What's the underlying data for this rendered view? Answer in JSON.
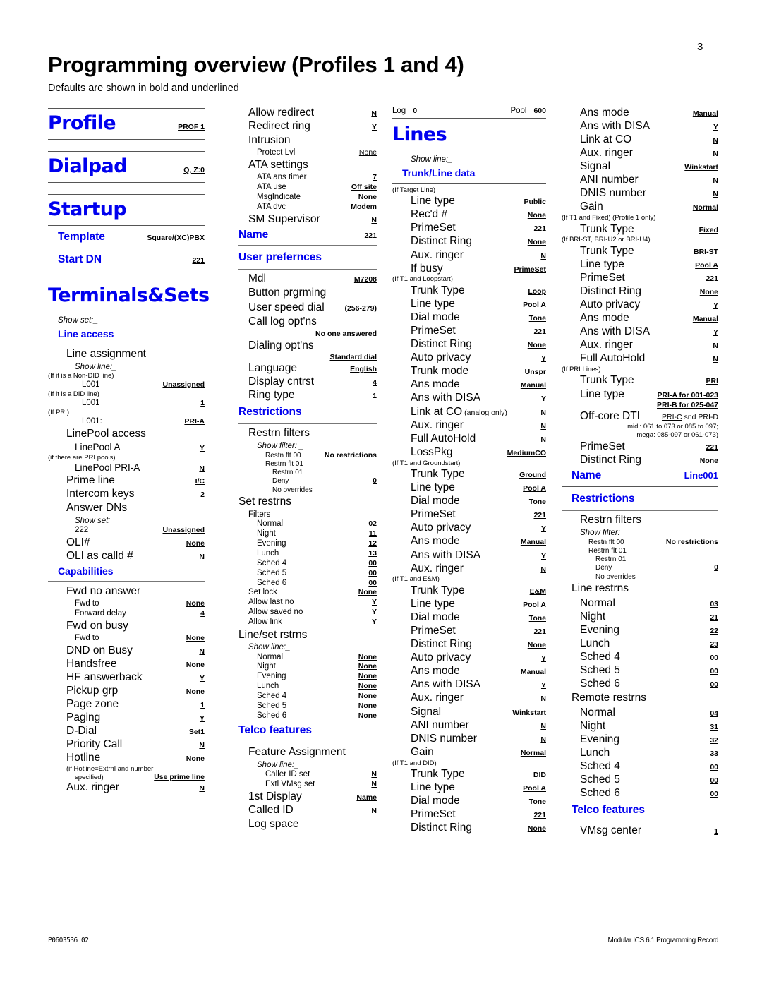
{
  "page": {
    "number": "3",
    "title": "Programming overview (Profiles 1 and 4)",
    "subtitle": "Defaults are shown in bold and underlined",
    "footer_left": "P0603536  02",
    "footer_right": "Modular ICS 6.1 Programming Record",
    "accent_color": "#0000ee"
  },
  "col1": {
    "profile": {
      "heading": "Profile",
      "value": "PROF 1"
    },
    "dialpad": {
      "heading": "Dialpad",
      "value": "Q, Z:0"
    },
    "startup": {
      "heading": "Startup"
    },
    "template": {
      "label": "Template",
      "value": "Square/(XC)PBX"
    },
    "start_dn": {
      "label": "Start DN",
      "value": "221"
    },
    "terminals": {
      "heading": "Terminals&Sets",
      "show_set": "Show set:_"
    },
    "line_access": {
      "heading": "Line access",
      "line_assignment": "Line assignment",
      "show_line": "Show line:_",
      "note_nondid": "(If it is a Non-DID line)",
      "l001_nondid_label": "L001",
      "l001_nondid_value": "Unassigned",
      "note_did": "(If it is a DID line)",
      "l001_did_label": "L001",
      "l001_did_value": "1",
      "note_pri": "(If PRI)",
      "l001_pri_label": "L001:",
      "l001_pri_value": "PRI-A",
      "linepool_access": "LinePool access",
      "linepool_a_label": "LinePool  A",
      "linepool_a_value": "Y",
      "note_pri_pools": "(if there are PRI pools)",
      "linepool_pria_label": "LinePool PRI-A",
      "linepool_pria_value": "N",
      "prime_line_label": "Prime line",
      "prime_line_value": "I/C",
      "intercom_keys_label": "Intercom keys",
      "intercom_keys_value": "2",
      "answer_dns": "Answer DNs",
      "answer_show_set": "Show set:_",
      "dn222_label": "222",
      "dn222_value": "Unassigned",
      "oli_label": "OLI#",
      "oli_value": "None",
      "oli_calld_label": "OLI as calld #",
      "oli_calld_value": "N"
    },
    "capabilities": {
      "heading": "Capabilities",
      "fwd_no_answer": "Fwd no answer",
      "fwd_to_1_label": "Fwd to",
      "fwd_to_1_value": "None",
      "forward_delay_label": "Forward delay",
      "forward_delay_value": "4",
      "fwd_on_busy": "Fwd on busy",
      "fwd_to_2_label": "Fwd to",
      "fwd_to_2_value": "None",
      "dnd_label": "DND on Busy",
      "dnd_value": "N",
      "handsfree_label": "Handsfree",
      "handsfree_value": "None",
      "hf_answerback_label": "HF answerback",
      "hf_answerback_value": "Y",
      "pickup_grp_label": "Pickup grp",
      "pickup_grp_value": "None",
      "page_zone_label": "Page zone",
      "page_zone_value": "1",
      "paging_label": "Paging",
      "paging_value": "Y",
      "ddial_label": "D-Dial",
      "ddial_value": "Set1",
      "priority_call_label": "Priority Call",
      "priority_call_value": "N",
      "hotline_label": "Hotline",
      "hotline_value": "None",
      "hotline_note1": "(if Hotline=Extrnl and number",
      "hotline_note2": "specified)",
      "hotline_note_value": "Use prime line",
      "aux_ringer_label": "Aux. ringer",
      "aux_ringer_value": "N"
    }
  },
  "col2": {
    "allow_redirect": {
      "label": "Allow redirect",
      "value": "N"
    },
    "redirect_ring": {
      "label": "Redirect ring",
      "value": "Y"
    },
    "intrusion": {
      "label": "Intrusion"
    },
    "protect_lvl": {
      "label": "Protect Lvl",
      "value": "None"
    },
    "ata_settings": {
      "label": "ATA settings"
    },
    "ata_ans_timer": {
      "label": "ATA ans timer",
      "value": "7"
    },
    "ata_use": {
      "label": "ATA use",
      "value": "Off site"
    },
    "msgindicate": {
      "label": "MsgIndicate",
      "value": "None"
    },
    "ata_dvc": {
      "label": "ATA dvc",
      "value": "Modem"
    },
    "sm_supervisor": {
      "label": "SM Supervisor",
      "value": "N"
    },
    "name": {
      "label": "Name",
      "value": "221"
    },
    "user_prefs": {
      "heading": "User prefernces",
      "mdl_label": "Mdl",
      "mdl_value": "M7208",
      "button_prgrming": "Button prgrming",
      "user_speed_dial_label": "User speed dial",
      "user_speed_dial_value": "(256-279)",
      "call_log_optns": "Call log opt'ns",
      "call_log_value": "No one answered",
      "dialing_optns": "Dialing opt'ns",
      "dialing_value": "Standard dial",
      "language_label": "Language",
      "language_value": "English",
      "display_cntrst_label": "Display cntrst",
      "display_cntrst_value": "4",
      "ring_type_label": "Ring type",
      "ring_type_value": "1"
    },
    "restrictions": {
      "heading": "Restrictions",
      "restrn_filters": "Restrn filters",
      "show_filter": "Show filter: _",
      "restn_flt_00_label": "Restn flt 00",
      "restn_flt_00_value": "No restrictions",
      "restrn_flt_01": "Restrn flt 01",
      "restrn_01": "Restrn 01",
      "deny_label": "Deny",
      "deny_value": "0",
      "no_overrides": "No overrides",
      "set_restrns": "Set restrns",
      "filters": "Filters",
      "filter_rows": [
        {
          "label": "Normal",
          "value": "02"
        },
        {
          "label": "Night",
          "value": "11"
        },
        {
          "label": "Evening",
          "value": "12"
        },
        {
          "label": "Lunch",
          "value": "13"
        },
        {
          "label": "Sched 4",
          "value": "00"
        },
        {
          "label": "Sched 5",
          "value": "00"
        },
        {
          "label": "Sched 6",
          "value": "00"
        }
      ],
      "set_lock_label": "Set lock",
      "set_lock_value": "None",
      "allow_last_no_label": "Allow last no",
      "allow_last_no_value": "Y",
      "allow_saved_no_label": "Allow saved no",
      "allow_saved_no_value": "Y",
      "allow_link_label": "Allow link",
      "allow_link_value": "Y",
      "line_set_rstrns": "Line/set rstrns",
      "show_line": "Show line:_",
      "lineset_rows": [
        {
          "label": "Normal",
          "value": "None"
        },
        {
          "label": "Night",
          "value": "None"
        },
        {
          "label": "Evening",
          "value": "None"
        },
        {
          "label": "Lunch",
          "value": "None"
        },
        {
          "label": "Sched 4",
          "value": "None"
        },
        {
          "label": "Sched 5",
          "value": "None"
        },
        {
          "label": "Sched 6",
          "value": "None"
        }
      ]
    },
    "telco": {
      "heading": "Telco features",
      "feature_assignment": "Feature Assignment",
      "show_line": "Show line:_",
      "caller_id_set_label": "Caller ID set",
      "caller_id_set_value": "N",
      "extl_vmsg_set_label": "Extl VMsg set",
      "extl_vmsg_set_value": "N",
      "first_display_label": "1st Display",
      "first_display_value": "Name",
      "called_id_label": "Called ID",
      "called_id_value": "N",
      "log_space": "Log space"
    }
  },
  "col3": {
    "log_label": "Log",
    "log_value": "0",
    "pool_label": "Pool",
    "pool_value": "600",
    "lines_heading": "Lines",
    "show_line": "Show line:_",
    "trunk_line_data": "Trunk/Line data",
    "target_line": {
      "note": "(If Target Line)",
      "rows": [
        {
          "label": "Line type",
          "value": "Public",
          "style": "bu"
        },
        {
          "label": "Rec'd #",
          "value": "None",
          "style": "bu"
        },
        {
          "label": "PrimeSet",
          "value": "221",
          "style": "bu"
        },
        {
          "label": "Distinct Ring",
          "value": "None",
          "style": "bu"
        },
        {
          "label": "Aux. ringer",
          "value": "N",
          "style": "bu"
        },
        {
          "label": "If busy",
          "value": "PrimeSet",
          "style": "bu"
        }
      ]
    },
    "t1_loopstart": {
      "note": "(If T1 and Loopstart)",
      "rows": [
        {
          "label": "Trunk Type",
          "value": "Loop",
          "style": "bu"
        },
        {
          "label": "Line type",
          "value": "Pool A",
          "style": "bu"
        },
        {
          "label": "Dial mode",
          "value": "Tone",
          "style": "bu"
        },
        {
          "label": "PrimeSet",
          "value": "221",
          "style": "bu"
        },
        {
          "label": "Distinct Ring",
          "value": "None",
          "style": "bu"
        },
        {
          "label": "Auto privacy",
          "value": "Y",
          "style": "bu"
        },
        {
          "label": "Trunk mode",
          "value": "Unspr",
          "style": "bu"
        },
        {
          "label": "Ans mode",
          "value": "Manual",
          "style": "bu"
        },
        {
          "label": "Ans with DISA",
          "value": "Y",
          "style": "bu"
        },
        {
          "label": "Link at CO",
          "sub": "(analog only)",
          "value": "N",
          "style": "bu"
        },
        {
          "label": "Aux. ringer",
          "value": "N",
          "style": "bu"
        },
        {
          "label": "Full AutoHold",
          "value": "N",
          "style": "bu"
        },
        {
          "label": "LossPkg",
          "value": "MediumCO",
          "style": "bu"
        }
      ]
    },
    "t1_groundstart": {
      "note": "(If T1 and Groundstart)",
      "rows": [
        {
          "label": "Trunk Type",
          "value": "Ground",
          "style": "bu"
        },
        {
          "label": "Line type",
          "value": "Pool A",
          "style": "bu"
        },
        {
          "label": "Dial mode",
          "value": "Tone",
          "style": "bu"
        },
        {
          "label": "PrimeSet",
          "value": "221",
          "style": "bu"
        },
        {
          "label": "Auto privacy",
          "value": "Y",
          "style": "bu"
        },
        {
          "label": "Ans mode",
          "value": "Manual",
          "style": "bu"
        },
        {
          "label": "Ans with DISA",
          "value": "Y",
          "style": "bu"
        },
        {
          "label": "Aux. ringer",
          "value": "N",
          "style": "bu"
        }
      ]
    },
    "t1_em": {
      "note": "(If T1 and E&M)",
      "rows": [
        {
          "label": "Trunk Type",
          "value": "E&M",
          "style": "bu"
        },
        {
          "label": "Line type",
          "value": "Pool A",
          "style": "bu"
        },
        {
          "label": "Dial mode",
          "value": "Tone",
          "style": "bu"
        },
        {
          "label": "PrimeSet",
          "value": "221",
          "style": "bu"
        },
        {
          "label": "Distinct Ring",
          "value": "None",
          "style": "bu"
        },
        {
          "label": "Auto privacy",
          "value": "Y",
          "style": "bu"
        },
        {
          "label": "Ans mode",
          "value": "Manual",
          "style": "bu"
        },
        {
          "label": "Ans with DISA",
          "value": "Y",
          "style": "bu"
        },
        {
          "label": "Aux. ringer",
          "value": "N",
          "style": "bu"
        },
        {
          "label": "Signal",
          "value": "Winkstart",
          "style": "bu"
        },
        {
          "label": "ANI number",
          "value": "N",
          "style": "bu"
        },
        {
          "label": "DNIS number",
          "value": "N",
          "style": "bu"
        },
        {
          "label": "Gain",
          "value": "Normal",
          "style": "bu"
        }
      ]
    },
    "t1_did": {
      "note": "(If T1 and DID)",
      "rows": [
        {
          "label": "Trunk Type",
          "value": "DID",
          "style": "bu"
        },
        {
          "label": "Line type",
          "value": "Pool A",
          "style": "bu"
        },
        {
          "label": "Dial mode",
          "value": "Tone",
          "style": "bu"
        },
        {
          "label": "PrimeSet",
          "value": "221",
          "style": "bu"
        },
        {
          "label": "Distinct Ring",
          "value": "None",
          "style": "bu"
        }
      ]
    }
  },
  "col4": {
    "did_cont": {
      "rows": [
        {
          "label": "Ans mode",
          "value": "Manual",
          "style": "bu"
        },
        {
          "label": "Ans with DISA",
          "value": "Y",
          "style": "bu"
        },
        {
          "label": "Link at CO",
          "value": "N",
          "style": "bu"
        },
        {
          "label": "Aux. ringer",
          "value": "N",
          "style": "bu"
        },
        {
          "label": "Signal",
          "value": "Winkstart",
          "style": "bu"
        },
        {
          "label": "ANI number",
          "value": "N",
          "style": "bu"
        },
        {
          "label": "DNIS number",
          "value": "N",
          "style": "bu"
        },
        {
          "label": "Gain",
          "value": "Normal",
          "style": "bu"
        }
      ]
    },
    "t1_fixed": {
      "note": "(If T1 and Fixed) (Profile 1 only)",
      "rows": [
        {
          "label": "Trunk Type",
          "value": "Fixed",
          "style": "bu"
        }
      ]
    },
    "bri": {
      "note": "(If BRI-ST, BRI-U2 or BRI-U4)",
      "rows": [
        {
          "label": "Trunk Type",
          "value": "BRI-ST",
          "style": "bu"
        },
        {
          "label": "Line type",
          "value": "Pool A",
          "style": "bu"
        },
        {
          "label": "PrimeSet",
          "value": "221",
          "style": "bu"
        },
        {
          "label": "Distinct Ring",
          "value": "None",
          "style": "bu"
        },
        {
          "label": "Auto privacy",
          "value": "Y",
          "style": "bu"
        },
        {
          "label": "Ans mode",
          "value": "Manual",
          "style": "bu"
        },
        {
          "label": "Ans with DISA",
          "value": "Y",
          "style": "bu"
        },
        {
          "label": "Aux. ringer",
          "value": "N",
          "style": "bu"
        },
        {
          "label": "Full AutoHold",
          "value": "N",
          "style": "bu"
        }
      ]
    },
    "pri": {
      "note": "(If PRI Lines).",
      "trunk_type_label": "Trunk Type",
      "trunk_type_value": "PRI",
      "line_type_label": "Line type",
      "line_type_value_a": "PRI-A for 001-023",
      "line_type_value_b": "PRI-B for 025-047",
      "offcore_label": "Off-core DTI",
      "offcore_value_underline": "PRI-C",
      "offcore_value_rest": " snd PRI-D",
      "offcore_note1": "midi: 061 to 073 or 085 to 097;",
      "offcore_note2": "mega: 085-097 or 061-073)",
      "primeset_label": "PrimeSet",
      "primeset_value": "221",
      "distinct_ring_label": "Distinct Ring",
      "distinct_ring_value": "None"
    },
    "name": {
      "label": "Name",
      "value": "Line001"
    },
    "restrictions": {
      "heading": "Restrictions",
      "restrn_filters": "Restrn filters",
      "show_filter": "Show filter: _",
      "restn_flt_00_label": "Restn flt 00",
      "restn_flt_00_value": "No restrictions",
      "restrn_flt_01": "Restrn flt 01",
      "restrn_01": "Restrn 01",
      "deny_label": "Deny",
      "deny_value": "0",
      "no_overrides": "No overrides",
      "line_restrns": "Line restrns",
      "line_rows": [
        {
          "label": "Normal",
          "value": "03"
        },
        {
          "label": "Night",
          "value": "21"
        },
        {
          "label": "Evening",
          "value": "22"
        },
        {
          "label": "Lunch",
          "value": "23"
        },
        {
          "label": "Sched 4",
          "value": "00"
        },
        {
          "label": "Sched 5",
          "value": "00"
        },
        {
          "label": "Sched 6",
          "value": "00"
        }
      ],
      "remote_restrns": "Remote restrns",
      "remote_rows": [
        {
          "label": "Normal",
          "value": "04"
        },
        {
          "label": "Night",
          "value": "31"
        },
        {
          "label": "Evening",
          "value": "32"
        },
        {
          "label": "Lunch",
          "value": "33"
        },
        {
          "label": "Sched 4",
          "value": "00"
        },
        {
          "label": "Sched 5",
          "value": "00"
        },
        {
          "label": "Sched 6",
          "value": "00"
        }
      ]
    },
    "telco": {
      "heading": "Telco features",
      "vmsg_center_label": "VMsg center",
      "vmsg_center_value": "1"
    }
  }
}
